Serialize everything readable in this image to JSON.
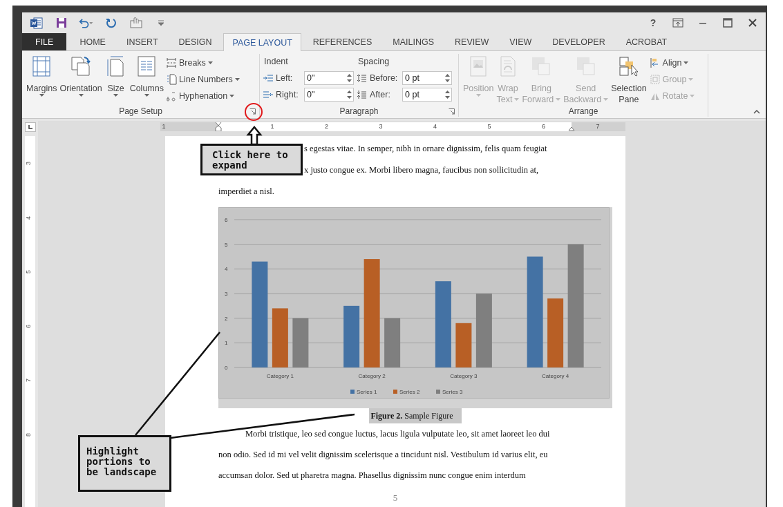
{
  "title_bar": {
    "help": "?"
  },
  "tabs": [
    {
      "label": "FILE",
      "kind": "file",
      "selected": false
    },
    {
      "label": "HOME",
      "kind": "tab",
      "selected": false
    },
    {
      "label": "INSERT",
      "kind": "tab",
      "selected": false
    },
    {
      "label": "DESIGN",
      "kind": "tab",
      "selected": false
    },
    {
      "label": "PAGE LAYOUT",
      "kind": "tab",
      "selected": true
    },
    {
      "label": "REFERENCES",
      "kind": "tab",
      "selected": false
    },
    {
      "label": "MAILINGS",
      "kind": "tab",
      "selected": false
    },
    {
      "label": "REVIEW",
      "kind": "tab",
      "selected": false
    },
    {
      "label": "VIEW",
      "kind": "tab",
      "selected": false
    },
    {
      "label": "DEVELOPER",
      "kind": "tab",
      "selected": false
    },
    {
      "label": "ACROBAT",
      "kind": "tab",
      "selected": false
    }
  ],
  "ribbon": {
    "page_setup": {
      "label": "Page Setup",
      "large_buttons": [
        {
          "label": "Margins",
          "dropdown": true
        },
        {
          "label": "Orientation",
          "dropdown": true
        },
        {
          "label": "Size",
          "dropdown": true
        },
        {
          "label": "Columns",
          "dropdown": true
        }
      ],
      "small_buttons": [
        {
          "label": "Breaks",
          "dropdown": true
        },
        {
          "label": "Line Numbers",
          "dropdown": true
        },
        {
          "label": "Hyphenation",
          "dropdown": true
        }
      ]
    },
    "paragraph": {
      "label": "Paragraph",
      "sections": [
        {
          "heading": "Indent",
          "fields": [
            {
              "label": "Left:",
              "value": "0\""
            },
            {
              "label": "Right:",
              "value": "0\""
            }
          ]
        },
        {
          "heading": "Spacing",
          "fields": [
            {
              "label": "Before:",
              "value": "0 pt"
            },
            {
              "label": "After:",
              "value": "0 pt"
            }
          ]
        }
      ]
    },
    "arrange": {
      "label": "Arrange",
      "large_buttons": [
        {
          "lines": [
            "Position"
          ],
          "dropdown": true,
          "disabled": true
        },
        {
          "lines": [
            "Wrap",
            "Text"
          ],
          "dropdown": true,
          "disabled": true
        },
        {
          "lines": [
            "Bring",
            "Forward"
          ],
          "dropdown": true,
          "disabled": true
        },
        {
          "lines": [
            "Send",
            "Backward"
          ],
          "dropdown": true,
          "disabled": true
        },
        {
          "lines": [
            "Selection",
            "Pane"
          ],
          "dropdown": false,
          "disabled": false
        }
      ],
      "small_buttons": [
        {
          "label": "Align",
          "dropdown": true,
          "disabled": false
        },
        {
          "label": "Group",
          "dropdown": true,
          "disabled": true
        },
        {
          "label": "Rotate",
          "dropdown": true,
          "disabled": true
        }
      ]
    }
  },
  "rulers": {
    "horizontal": [
      "1",
      "1",
      "2",
      "3",
      "4",
      "5",
      "6",
      "7"
    ],
    "vertical": [
      "3",
      "4",
      "5",
      "6",
      "7",
      "8"
    ]
  },
  "document": {
    "paragraph_1": [
      "s egestas vitae. In semper, nibh in ornare dignissim, felis quam feugiat",
      "x justo congue ex. Morbi libero magna, faucibus non sollicitudin at,",
      "imperdiet a nisl."
    ],
    "chart_data": {
      "type": "bar",
      "categories": [
        "Category 1",
        "Category 2",
        "Category 3",
        "Category 4"
      ],
      "series": [
        {
          "name": "Series 1",
          "color": "#4472a4",
          "values": [
            4.3,
            2.5,
            3.5,
            4.5
          ]
        },
        {
          "name": "Series 2",
          "color": "#b85f25",
          "values": [
            2.4,
            4.4,
            1.8,
            2.8
          ]
        },
        {
          "name": "Series 3",
          "color": "#7f7f7f",
          "values": [
            2,
            2,
            3,
            5
          ]
        }
      ],
      "ylim": [
        0,
        6
      ],
      "yticks": [
        0,
        1,
        2,
        3,
        4,
        5,
        6
      ],
      "grid": true,
      "legend": true
    },
    "caption": "**Figure 2.** Sample Figure",
    "paragraph_2": [
      "Morbi tristique, leo sed congue luctus, lacus ligula vulputate leo, sit amet laoreet leo dui",
      "non odio. Sed id mi vel velit dignissim scelerisque a tincidunt nisl. Vestibulum id varius elit, eu",
      "accumsan dolor. Sed ut pharetra magna. Phasellus dignissim nunc congue enim interdum"
    ],
    "page_number": "5"
  },
  "annotations": [
    {
      "kind": "callout",
      "text": "Click here to expand"
    },
    {
      "kind": "callout",
      "text": "Highlight portions to be landscape"
    }
  ]
}
